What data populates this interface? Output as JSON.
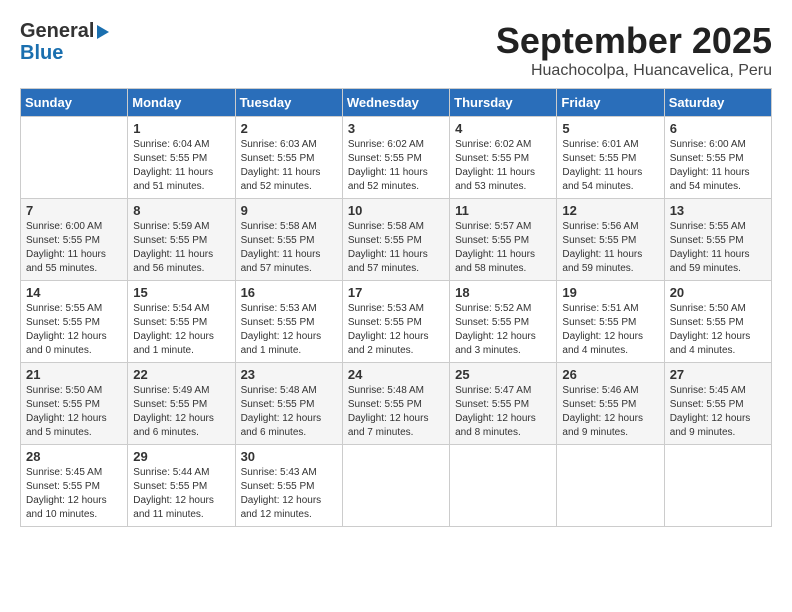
{
  "header": {
    "logo_line1": "General",
    "logo_line2": "Blue",
    "month": "September 2025",
    "location": "Huachocolpa, Huancavelica, Peru"
  },
  "days_of_week": [
    "Sunday",
    "Monday",
    "Tuesday",
    "Wednesday",
    "Thursday",
    "Friday",
    "Saturday"
  ],
  "weeks": [
    [
      {
        "day": "",
        "info": ""
      },
      {
        "day": "1",
        "info": "Sunrise: 6:04 AM\nSunset: 5:55 PM\nDaylight: 11 hours\nand 51 minutes."
      },
      {
        "day": "2",
        "info": "Sunrise: 6:03 AM\nSunset: 5:55 PM\nDaylight: 11 hours\nand 52 minutes."
      },
      {
        "day": "3",
        "info": "Sunrise: 6:02 AM\nSunset: 5:55 PM\nDaylight: 11 hours\nand 52 minutes."
      },
      {
        "day": "4",
        "info": "Sunrise: 6:02 AM\nSunset: 5:55 PM\nDaylight: 11 hours\nand 53 minutes."
      },
      {
        "day": "5",
        "info": "Sunrise: 6:01 AM\nSunset: 5:55 PM\nDaylight: 11 hours\nand 54 minutes."
      },
      {
        "day": "6",
        "info": "Sunrise: 6:00 AM\nSunset: 5:55 PM\nDaylight: 11 hours\nand 54 minutes."
      }
    ],
    [
      {
        "day": "7",
        "info": "Sunrise: 6:00 AM\nSunset: 5:55 PM\nDaylight: 11 hours\nand 55 minutes."
      },
      {
        "day": "8",
        "info": "Sunrise: 5:59 AM\nSunset: 5:55 PM\nDaylight: 11 hours\nand 56 minutes."
      },
      {
        "day": "9",
        "info": "Sunrise: 5:58 AM\nSunset: 5:55 PM\nDaylight: 11 hours\nand 57 minutes."
      },
      {
        "day": "10",
        "info": "Sunrise: 5:58 AM\nSunset: 5:55 PM\nDaylight: 11 hours\nand 57 minutes."
      },
      {
        "day": "11",
        "info": "Sunrise: 5:57 AM\nSunset: 5:55 PM\nDaylight: 11 hours\nand 58 minutes."
      },
      {
        "day": "12",
        "info": "Sunrise: 5:56 AM\nSunset: 5:55 PM\nDaylight: 11 hours\nand 59 minutes."
      },
      {
        "day": "13",
        "info": "Sunrise: 5:55 AM\nSunset: 5:55 PM\nDaylight: 11 hours\nand 59 minutes."
      }
    ],
    [
      {
        "day": "14",
        "info": "Sunrise: 5:55 AM\nSunset: 5:55 PM\nDaylight: 12 hours\nand 0 minutes."
      },
      {
        "day": "15",
        "info": "Sunrise: 5:54 AM\nSunset: 5:55 PM\nDaylight: 12 hours\nand 1 minute."
      },
      {
        "day": "16",
        "info": "Sunrise: 5:53 AM\nSunset: 5:55 PM\nDaylight: 12 hours\nand 1 minute."
      },
      {
        "day": "17",
        "info": "Sunrise: 5:53 AM\nSunset: 5:55 PM\nDaylight: 12 hours\nand 2 minutes."
      },
      {
        "day": "18",
        "info": "Sunrise: 5:52 AM\nSunset: 5:55 PM\nDaylight: 12 hours\nand 3 minutes."
      },
      {
        "day": "19",
        "info": "Sunrise: 5:51 AM\nSunset: 5:55 PM\nDaylight: 12 hours\nand 4 minutes."
      },
      {
        "day": "20",
        "info": "Sunrise: 5:50 AM\nSunset: 5:55 PM\nDaylight: 12 hours\nand 4 minutes."
      }
    ],
    [
      {
        "day": "21",
        "info": "Sunrise: 5:50 AM\nSunset: 5:55 PM\nDaylight: 12 hours\nand 5 minutes."
      },
      {
        "day": "22",
        "info": "Sunrise: 5:49 AM\nSunset: 5:55 PM\nDaylight: 12 hours\nand 6 minutes."
      },
      {
        "day": "23",
        "info": "Sunrise: 5:48 AM\nSunset: 5:55 PM\nDaylight: 12 hours\nand 6 minutes."
      },
      {
        "day": "24",
        "info": "Sunrise: 5:48 AM\nSunset: 5:55 PM\nDaylight: 12 hours\nand 7 minutes."
      },
      {
        "day": "25",
        "info": "Sunrise: 5:47 AM\nSunset: 5:55 PM\nDaylight: 12 hours\nand 8 minutes."
      },
      {
        "day": "26",
        "info": "Sunrise: 5:46 AM\nSunset: 5:55 PM\nDaylight: 12 hours\nand 9 minutes."
      },
      {
        "day": "27",
        "info": "Sunrise: 5:45 AM\nSunset: 5:55 PM\nDaylight: 12 hours\nand 9 minutes."
      }
    ],
    [
      {
        "day": "28",
        "info": "Sunrise: 5:45 AM\nSunset: 5:55 PM\nDaylight: 12 hours\nand 10 minutes."
      },
      {
        "day": "29",
        "info": "Sunrise: 5:44 AM\nSunset: 5:55 PM\nDaylight: 12 hours\nand 11 minutes."
      },
      {
        "day": "30",
        "info": "Sunrise: 5:43 AM\nSunset: 5:55 PM\nDaylight: 12 hours\nand 12 minutes."
      },
      {
        "day": "",
        "info": ""
      },
      {
        "day": "",
        "info": ""
      },
      {
        "day": "",
        "info": ""
      },
      {
        "day": "",
        "info": ""
      }
    ]
  ]
}
